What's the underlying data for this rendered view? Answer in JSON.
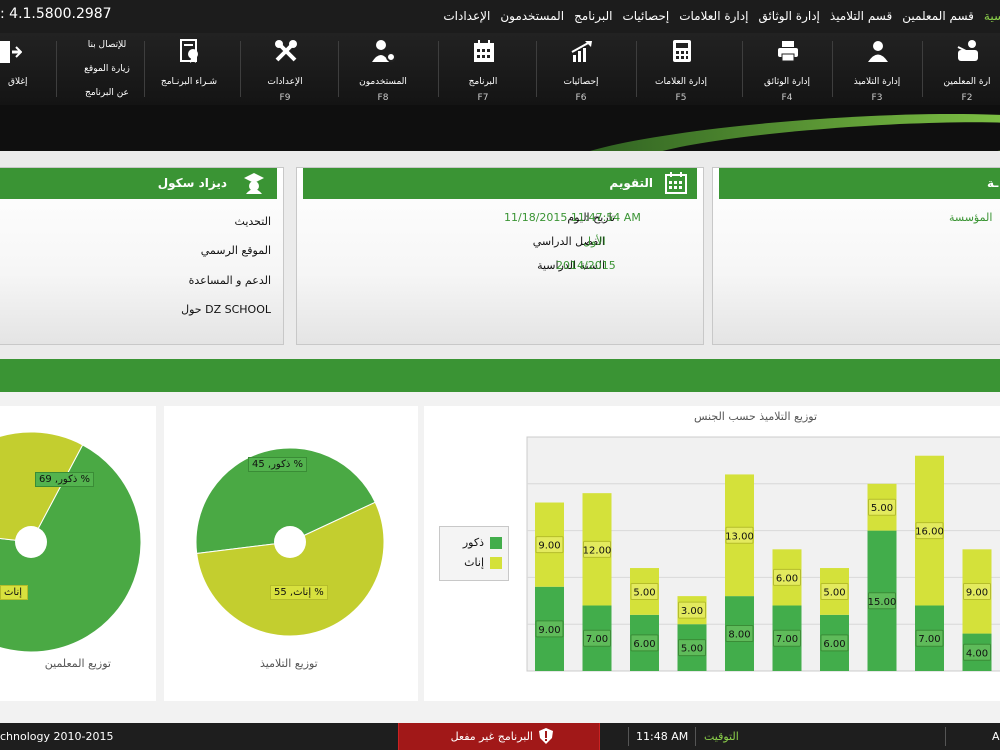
{
  "version": ": 4.1.5800.2987",
  "menu": [
    "سية",
    "قسم المعلمين",
    "قسم التلاميذ",
    "إدارة الوثائق",
    "إدارة العلامات",
    "إحصائيات",
    "البرنامج",
    "المستخدمون",
    "الإعدادات"
  ],
  "toolbar": {
    "teachers": {
      "label": "ارة المعلمين",
      "key": "F2"
    },
    "students": {
      "label": "إدارة التلاميذ",
      "key": "F3"
    },
    "documents": {
      "label": "إدارة الوثائق",
      "key": "F4"
    },
    "grades": {
      "label": "إدارة العلامات",
      "key": "F5"
    },
    "stats": {
      "label": "إحصائيات",
      "key": "F6"
    },
    "program": {
      "label": "البرنامج",
      "key": "F7"
    },
    "users": {
      "label": "المستخدمون",
      "key": "F8"
    },
    "settings": {
      "label": "الإعدادات",
      "key": "F9"
    },
    "buy": {
      "label": "شـراء البرنـامج"
    },
    "contact": "للإتصال بنا",
    "website": "زيارة الموقع",
    "about": "عن البرنامج",
    "close": "إغلاق"
  },
  "panels": {
    "institution": {
      "title": "ـة",
      "row1": "المؤسسة"
    },
    "calendar": {
      "title": "التقويم",
      "date_label": "تاريخ اليوم",
      "date_value": "11/18/2015 11:47:54 AM",
      "term_label": "الفصل الدراسي",
      "term_value": "الأول",
      "year_label": "السنة الدراسية",
      "year_value": "2014/2015"
    },
    "dizad": {
      "title": "ديزاد سكول",
      "update": "التحديث",
      "website": "الموقع الرسمي",
      "support": "الدعم و المساعدة",
      "about": "حول DZ SCHOOL"
    }
  },
  "charts": {
    "teachers_pie": {
      "title": "توزيع المعلمين",
      "male": "ذكور, 69 %",
      "female": "إناث"
    },
    "students_pie": {
      "title": "توزيع التلاميذ",
      "male": "ذكور, 45 %",
      "female": "إناث, 55 %"
    },
    "gender_bar": {
      "title": "توزيع التلاميذ حسب الجنس",
      "legend_male": "ذكور",
      "legend_female": "إناث"
    }
  },
  "chart_data": [
    {
      "type": "pie",
      "title": "توزيع المعلمين",
      "slices": [
        {
          "label": "ذكور",
          "value": 69
        },
        {
          "label": "إناث",
          "value": 31
        }
      ]
    },
    {
      "type": "pie",
      "title": "توزيع التلاميذ",
      "slices": [
        {
          "label": "ذكور",
          "value": 45
        },
        {
          "label": "إناث",
          "value": 55
        }
      ]
    },
    {
      "type": "bar",
      "stacked": true,
      "title": "توزيع التلاميذ حسب الجنس",
      "ylim": [
        0,
        25
      ],
      "series": [
        {
          "name": "ذكور",
          "values": [
            9,
            7,
            6,
            5,
            8,
            7,
            6,
            15,
            7,
            4
          ]
        },
        {
          "name": "إناث",
          "values": [
            9,
            12,
            5,
            3,
            13,
            6,
            5,
            5,
            16,
            9
          ]
        }
      ]
    }
  ],
  "status": {
    "copyright": "chnology 2010-2015",
    "warning": "البرنامج غير مفعل",
    "time_label": "التوقيت",
    "time_value": "11:48 AM",
    "right_cut": "A"
  },
  "colors": {
    "green": "#3a9434",
    "light_green": "#8bd04a",
    "bar_male": "#42ad4b",
    "bar_female": "#d4e13a",
    "warn": "#a11818"
  }
}
